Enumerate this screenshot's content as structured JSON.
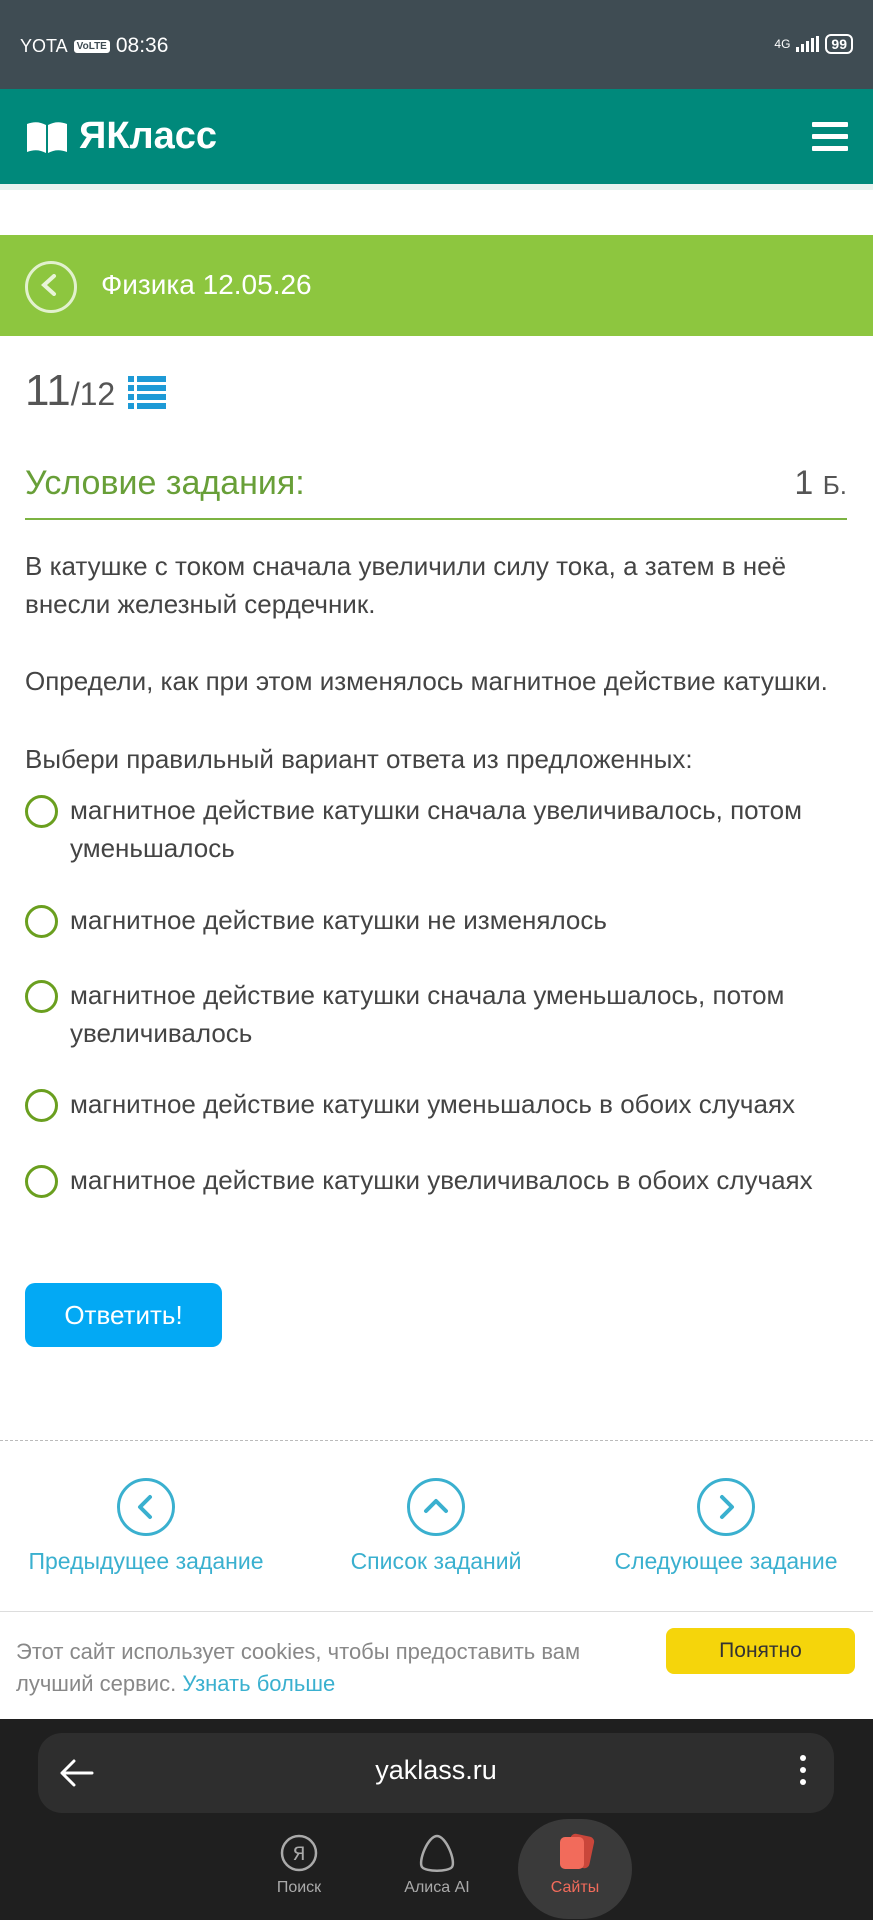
{
  "status_bar": {
    "carrier": "YOTA",
    "volte": "VoLTE",
    "time": "08:36",
    "network": "4G",
    "battery": "99"
  },
  "header": {
    "logo_text": "ЯКласс",
    "menu_icon": "hamburger-icon",
    "brand_color": "#00897b"
  },
  "subject": {
    "title": "Физика 12.05.26",
    "bar_color": "#8dc63f"
  },
  "task_counter": {
    "current": "11",
    "total": "/12"
  },
  "condition": {
    "title": "Условие задания:",
    "points": "1",
    "points_unit": "Б."
  },
  "question": {
    "paragraph1": "В катушке с током сначала увеличили силу тока, а затем в неё внесли железный сердечник.",
    "paragraph2": "Определи, как при этом изменялось магнитное действие катушки.",
    "instruction": "Выбери правильный вариант ответа из предложенных:"
  },
  "options": [
    "магнитное действие катушки сначала увеличивалось, потом уменьшалось",
    "магнитное действие катушки не изменялось",
    "магнитное действие катушки сначала уменьшалось, потом увеличивалось",
    "магнитное действие катушки уменьшалось в обоих случаях",
    "магнитное действие катушки увеличивалось в обоих случаях"
  ],
  "answer_button": "Ответить!",
  "navigation": {
    "prev": "Предыдущее задание",
    "list": "Список заданий",
    "next": "Следующее задание"
  },
  "cookie_banner": {
    "text": "Этот сайт использует cookies, чтобы предоставить вам лучший сервис.",
    "link": "Узнать больше",
    "button": "Понятно"
  },
  "browser": {
    "url": "yaklass.ru",
    "tabs": [
      "Поиск",
      "Алиса AI",
      "Сайты"
    ]
  }
}
